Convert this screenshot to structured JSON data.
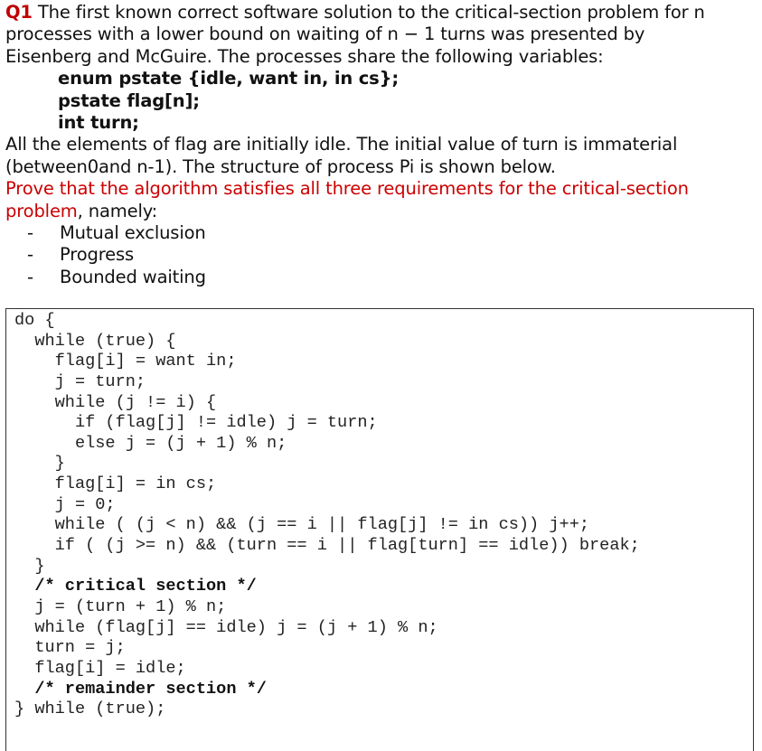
{
  "question": {
    "label": "Q1",
    "intro_lines": [
      " The first known correct software solution to the critical-section problem for n",
      "processes with a lower bound on waiting of n − 1 turns was presented by",
      "Eisenberg and McGuire. The processes share the following variables:"
    ],
    "declarations": [
      "enum pstate {idle, want in, in cs};",
      "pstate flag[n];",
      "int turn;"
    ],
    "description_lines": [
      "All the elements of flag are initially idle. The initial value of turn is immaterial",
      "(between0and n-1). The structure of process Pi is shown below."
    ],
    "task_red_line1": "Prove that the algorithm satisfies all three requirements for the critical-section",
    "task_red_line2": "problem",
    "task_suffix": ", namely:",
    "requirements": [
      "Mutual exclusion",
      "Progress",
      "Bounded waiting"
    ],
    "bullet": "-"
  },
  "code": {
    "lines": [
      {
        "text": "do {",
        "comment": false
      },
      {
        "text": "  while (true) {",
        "comment": false
      },
      {
        "text": "    flag[i] = want in;",
        "comment": false
      },
      {
        "text": "    j = turn;",
        "comment": false
      },
      {
        "text": "    while (j != i) {",
        "comment": false
      },
      {
        "text": "      if (flag[j] != idle) j = turn;",
        "comment": false
      },
      {
        "text": "      else j = (j + 1) % n;",
        "comment": false
      },
      {
        "text": "    }",
        "comment": false
      },
      {
        "text": "    flag[i] = in cs;",
        "comment": false
      },
      {
        "text": "    j = 0;",
        "comment": false
      },
      {
        "text": "    while ( (j < n) && (j == i || flag[j] != in cs)) j++;",
        "comment": false
      },
      {
        "text": "    if ( (j >= n) && (turn == i || flag[turn] == idle)) break;",
        "comment": false
      },
      {
        "text": "  }",
        "comment": false
      },
      {
        "text": "  /* critical section */",
        "comment": true
      },
      {
        "text": "  j = (turn + 1) % n;",
        "comment": false
      },
      {
        "text": "  while (flag[j] == idle) j = (j + 1) % n;",
        "comment": false
      },
      {
        "text": "  turn = j;",
        "comment": false
      },
      {
        "text": "  flag[i] = idle;",
        "comment": false
      },
      {
        "text": "  /* remainder section */",
        "comment": true
      },
      {
        "text": "} while (true);",
        "comment": false
      }
    ]
  }
}
